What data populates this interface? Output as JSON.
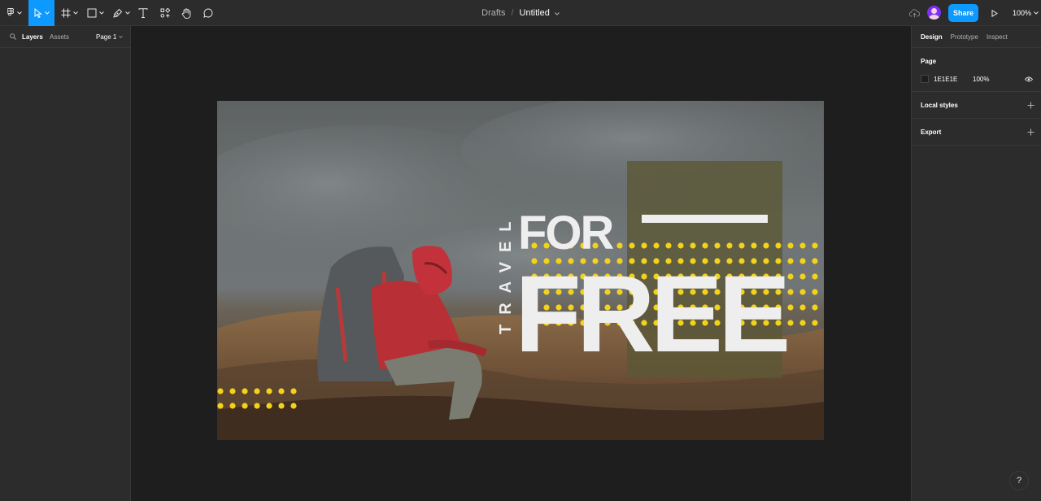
{
  "toolbar": {
    "tools": [
      {
        "name": "main-menu",
        "icon": "figma-logo-icon"
      },
      {
        "name": "move-tool",
        "icon": "cursor-icon",
        "active": true
      },
      {
        "name": "frame-tool",
        "icon": "frame-icon"
      },
      {
        "name": "shape-tool",
        "icon": "rectangle-icon"
      },
      {
        "name": "pen-tool",
        "icon": "pen-icon"
      },
      {
        "name": "text-tool",
        "icon": "text-icon"
      },
      {
        "name": "resources-tool",
        "icon": "components-icon"
      },
      {
        "name": "hand-tool",
        "icon": "hand-icon"
      },
      {
        "name": "comment-tool",
        "icon": "comment-icon"
      }
    ],
    "breadcrumb": {
      "folder": "Drafts",
      "separator": "/",
      "file": "Untitled"
    },
    "share_label": "Share",
    "zoom_label": "100%",
    "accent_color": "#0d99ff"
  },
  "left_panel": {
    "tabs": [
      {
        "label": "Layers",
        "active": true
      },
      {
        "label": "Assets",
        "active": false
      }
    ],
    "page_selector": "Page 1"
  },
  "right_panel": {
    "tabs": [
      {
        "label": "Design",
        "active": true
      },
      {
        "label": "Prototype",
        "active": false
      },
      {
        "label": "Inspect",
        "active": false
      }
    ],
    "page_section": {
      "heading": "Page",
      "color_hex": "1E1E1E",
      "opacity": "100%",
      "swatch_color": "#1e1e1e"
    },
    "local_styles_heading": "Local styles",
    "export_heading": "Export"
  },
  "canvas": {
    "background": "#1e1e1e",
    "artwork": {
      "vertical_text": "TRAVEL",
      "line1": "FOR",
      "line2": "FREE",
      "dot_color": "#f2d21b",
      "overlay_color": "#5b5836",
      "text_color": "#eeeeee"
    }
  },
  "help_label": "?"
}
